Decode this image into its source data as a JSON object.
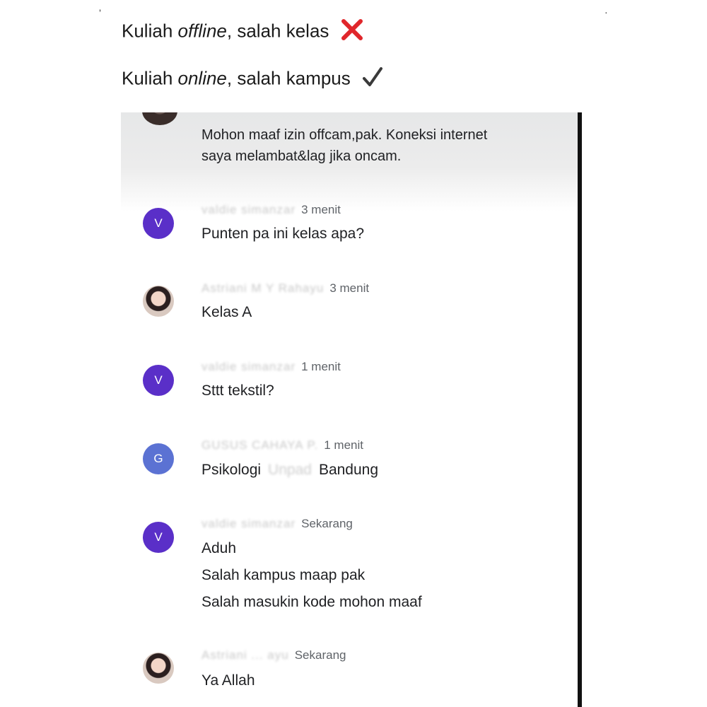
{
  "captions": {
    "line1": {
      "prefix": "Kuliah ",
      "emph": "offline",
      "suffix": ", salah kelas",
      "mark": "cross-icon"
    },
    "line2": {
      "prefix": "Kuliah ",
      "emph": "online",
      "suffix": ", salah kampus",
      "mark": "check-icon"
    }
  },
  "colors": {
    "cross": "#e0262b",
    "check": "#3a3a3a",
    "avatar_purple": "#5a2fc8",
    "avatar_blue": "#5b72d3"
  },
  "chat": {
    "top_message": {
      "line1": "Mohon maaf izin offcam,pak. Koneksi internet",
      "line2": "saya melambat&lag jika oncam."
    },
    "messages": [
      {
        "avatar_letter": "V",
        "name": "valdie simanzar",
        "time": "3 menit",
        "lines": [
          "Punten pa ini kelas apa?"
        ]
      },
      {
        "name": "Astriani M Y Rahayu",
        "time": "3 menit",
        "lines": [
          "Kelas A"
        ]
      },
      {
        "avatar_letter": "V",
        "name": "valdie simanzar",
        "time": "1 menit",
        "lines": [
          "Sttt tekstil?"
        ]
      },
      {
        "avatar_letter": "G",
        "name": "GUSUS CAHAYA P.",
        "time": "1 menit",
        "line_parts": {
          "before": "Psikologi",
          "hidden": "Unpad",
          "after": "Bandung"
        }
      },
      {
        "avatar_letter": "V",
        "name": "valdie simanzar",
        "time": "Sekarang",
        "lines": [
          "Aduh",
          "Salah kampus maap pak",
          "Salah masukin kode mohon maaf"
        ]
      },
      {
        "name": "Astriani ... ayu",
        "time": "Sekarang",
        "lines": [
          "Ya Allah"
        ]
      }
    ]
  }
}
